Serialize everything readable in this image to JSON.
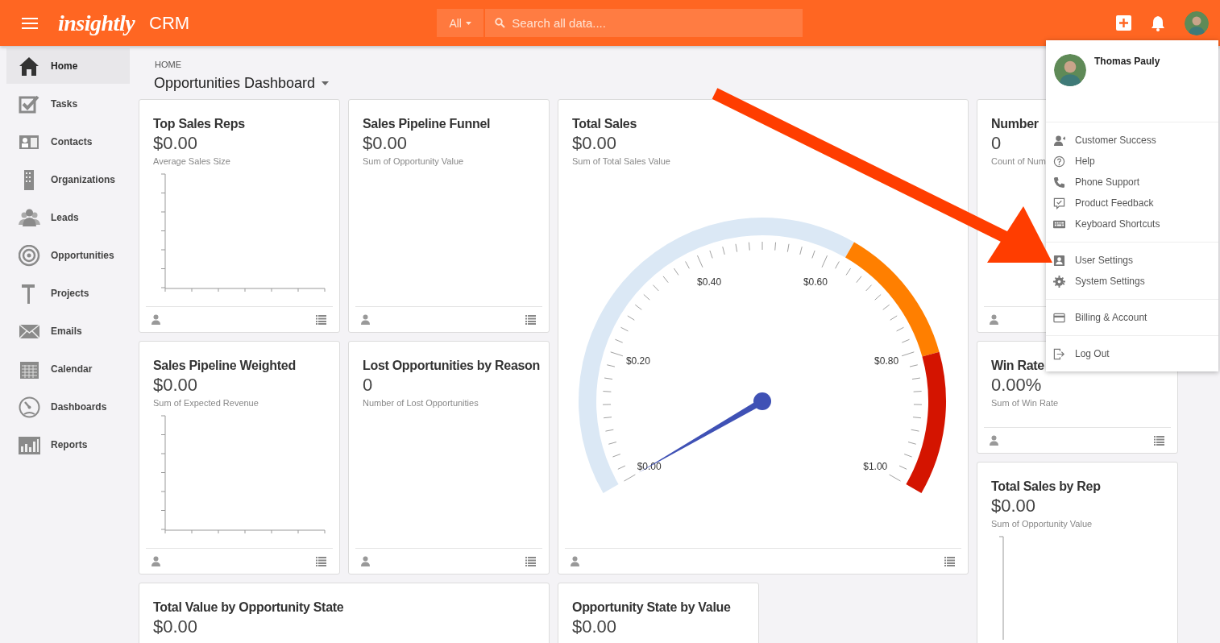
{
  "app": {
    "logo": "insightly",
    "product": "CRM"
  },
  "search": {
    "scope": "All",
    "placeholder": "Search all data...."
  },
  "sidebar": {
    "items": [
      {
        "label": "Home",
        "selected": true
      },
      {
        "label": "Tasks",
        "selected": false
      },
      {
        "label": "Contacts",
        "selected": false
      },
      {
        "label": "Organizations",
        "selected": false
      },
      {
        "label": "Leads",
        "selected": false
      },
      {
        "label": "Opportunities",
        "selected": false
      },
      {
        "label": "Projects",
        "selected": false
      },
      {
        "label": "Emails",
        "selected": false
      },
      {
        "label": "Calendar",
        "selected": false
      },
      {
        "label": "Dashboards",
        "selected": false
      },
      {
        "label": "Reports",
        "selected": false
      }
    ]
  },
  "breadcrumb": "HOME",
  "dashboard_title": "Opportunities Dashboard",
  "cards": [
    {
      "kind": "axes",
      "title": "Top Sales Reps",
      "value": "$0.00",
      "subtitle": "Average Sales Size",
      "footer": true
    },
    {
      "kind": "plain",
      "title": "Sales Pipeline Funnel",
      "value": "$0.00",
      "subtitle": "Sum of Opportunity Value",
      "footer": true
    },
    {
      "kind": "gauge",
      "title": "Total Sales",
      "value": "$0.00",
      "subtitle": "Sum of Total Sales Value",
      "footer": true,
      "gauge": {
        "labels": [
          "$0.00",
          "$0.20",
          "$0.40",
          "$0.60",
          "$0.80",
          "$1.00"
        ]
      }
    },
    {
      "kind": "plain",
      "title": "Number",
      "value": "0",
      "subtitle": "Count of Num",
      "footer": true
    },
    {
      "kind": "axes",
      "title": "Sales Pipeline Weighted",
      "value": "$0.00",
      "subtitle": "Sum of Expected Revenue",
      "footer": true
    },
    {
      "kind": "plain",
      "title": "Lost Opportunities by Reason",
      "value": "0",
      "subtitle": "Number of Lost Opportunities",
      "footer": true
    },
    {
      "kind": "plain",
      "title": "Win Rate",
      "value": "0.00%",
      "subtitle": "Sum of Win Rate",
      "footer": true
    },
    {
      "kind": "axes",
      "title": "Total Sales by Rep",
      "value": "$0.00",
      "subtitle": "Sum of Opportunity Value"
    },
    {
      "kind": "plain",
      "title": "Total Value by Opportunity State",
      "value": "$0.00"
    },
    {
      "kind": "plain",
      "title": "Opportunity State by Value",
      "value": "$0.00"
    }
  ],
  "user_menu": {
    "name": "Thomas Pauly",
    "groups": [
      {
        "items": [
          {
            "label": "Customer Success"
          },
          {
            "label": "Help"
          },
          {
            "label": "Phone Support"
          },
          {
            "label": "Product Feedback"
          },
          {
            "label": "Keyboard Shortcuts"
          }
        ]
      },
      {
        "items": [
          {
            "label": "User Settings"
          },
          {
            "label": "System Settings"
          }
        ]
      },
      {
        "items": [
          {
            "label": "Billing & Account"
          }
        ]
      },
      {
        "items": [
          {
            "label": "Log Out"
          }
        ]
      }
    ]
  }
}
